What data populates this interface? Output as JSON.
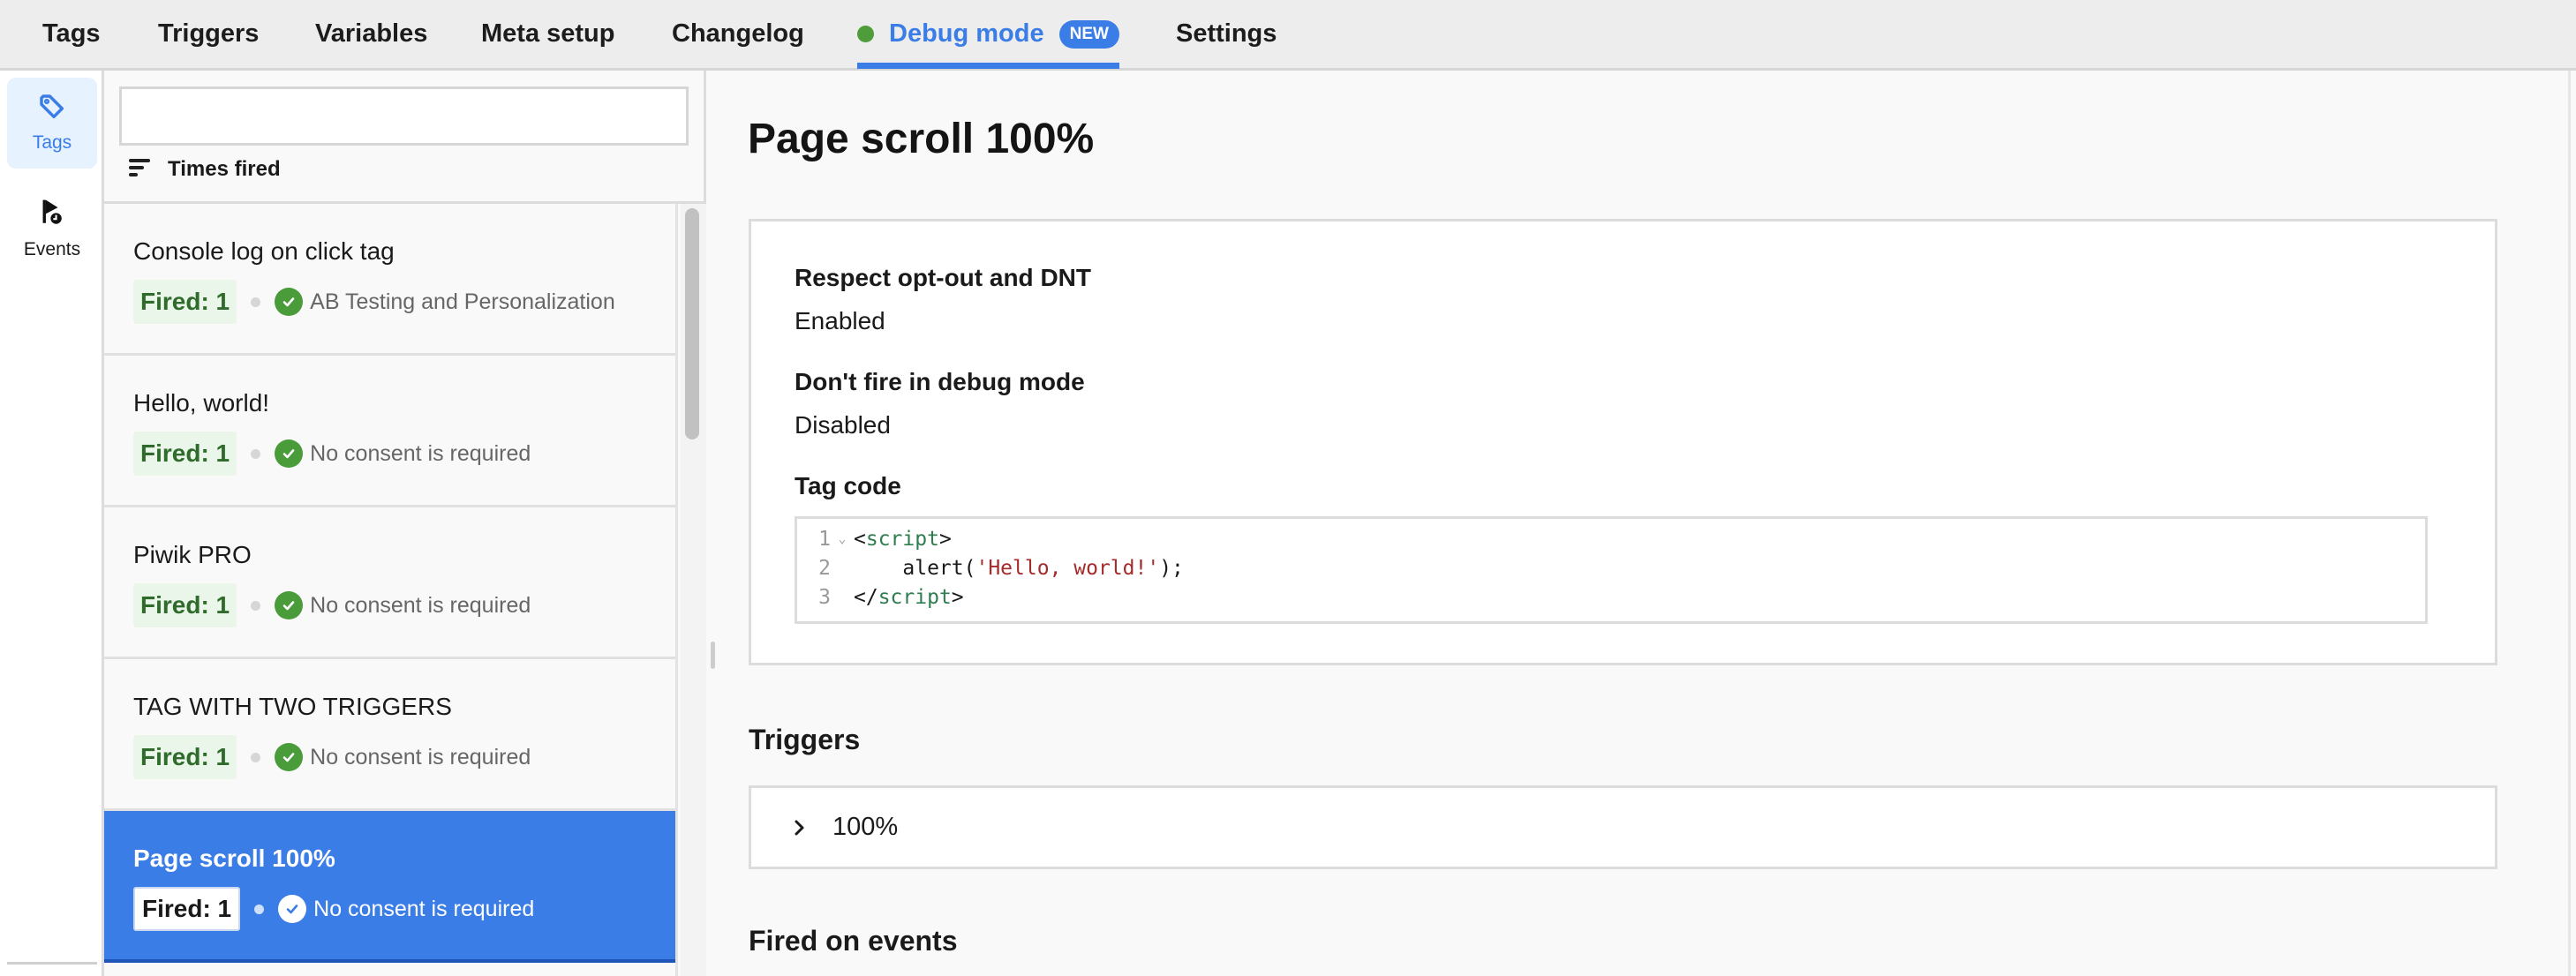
{
  "topnav": {
    "tabs": [
      {
        "label": "Tags"
      },
      {
        "label": "Triggers"
      },
      {
        "label": "Variables"
      },
      {
        "label": "Meta setup"
      },
      {
        "label": "Changelog"
      },
      {
        "label": "Debug mode",
        "badge": "NEW",
        "active": true,
        "status_color": "#4f9d3a"
      },
      {
        "label": "Settings"
      }
    ],
    "accent_color": "#3b7de6"
  },
  "rail": {
    "items": [
      {
        "label": "Tags",
        "icon": "tag-icon",
        "active": true
      },
      {
        "label": "Events",
        "icon": "flag-clock-icon"
      }
    ]
  },
  "list": {
    "search_value": "",
    "sort_label": "Times fired",
    "items": [
      {
        "name": "Console log on click tag",
        "fired": "Fired: 1",
        "consent": "AB Testing and Personalization"
      },
      {
        "name": "Hello, world!",
        "fired": "Fired: 1",
        "consent": "No consent is required"
      },
      {
        "name": "Piwik PRO",
        "fired": "Fired: 1",
        "consent": "No consent is required"
      },
      {
        "name": "TAG WITH TWO TRIGGERS",
        "fired": "Fired: 1",
        "consent": "No consent is required"
      },
      {
        "name": "Page scroll 100%",
        "fired": "Fired: 1",
        "consent": "No consent is required",
        "selected": true
      }
    ]
  },
  "detail": {
    "title": "Page scroll 100%",
    "fields": [
      {
        "label": "Respect opt-out and DNT",
        "value": "Enabled"
      },
      {
        "label": "Don't fire in debug mode",
        "value": "Disabled"
      }
    ],
    "code_label": "Tag code",
    "code_lines": [
      {
        "n": "1",
        "open": "<",
        "tag": "script",
        "close": ">"
      },
      {
        "n": "2",
        "pre": "    alert(",
        "str": "'Hello, world!'",
        "post": ");"
      },
      {
        "n": "3",
        "open": "</",
        "tag": "script",
        "close": ">"
      }
    ],
    "triggers_title": "Triggers",
    "triggers": [
      {
        "label": "100%"
      }
    ],
    "fired_on_title": "Fired on events"
  }
}
